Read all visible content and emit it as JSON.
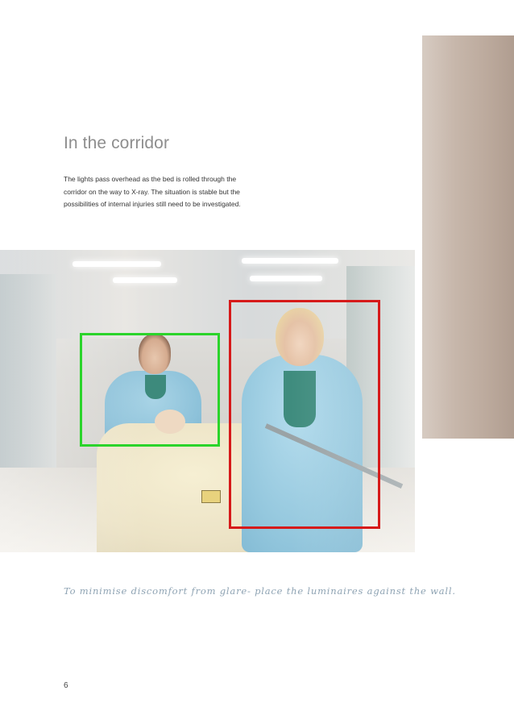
{
  "heading": "In the corridor",
  "body_lines": [
    "The lights pass overhead as the bed is rolled through the",
    "corridor on the way to X-ray. The situation is stable but the",
    "possibilities of internal injuries still need to be investigated."
  ],
  "caption": "To minimise discomfort from glare- place the luminaires against the wall.",
  "page_number": "6",
  "colors": {
    "green_box": "#2bd42b",
    "red_box": "#d61a1a",
    "heading": "#8e8e8e",
    "caption": "#8ea3b3"
  }
}
